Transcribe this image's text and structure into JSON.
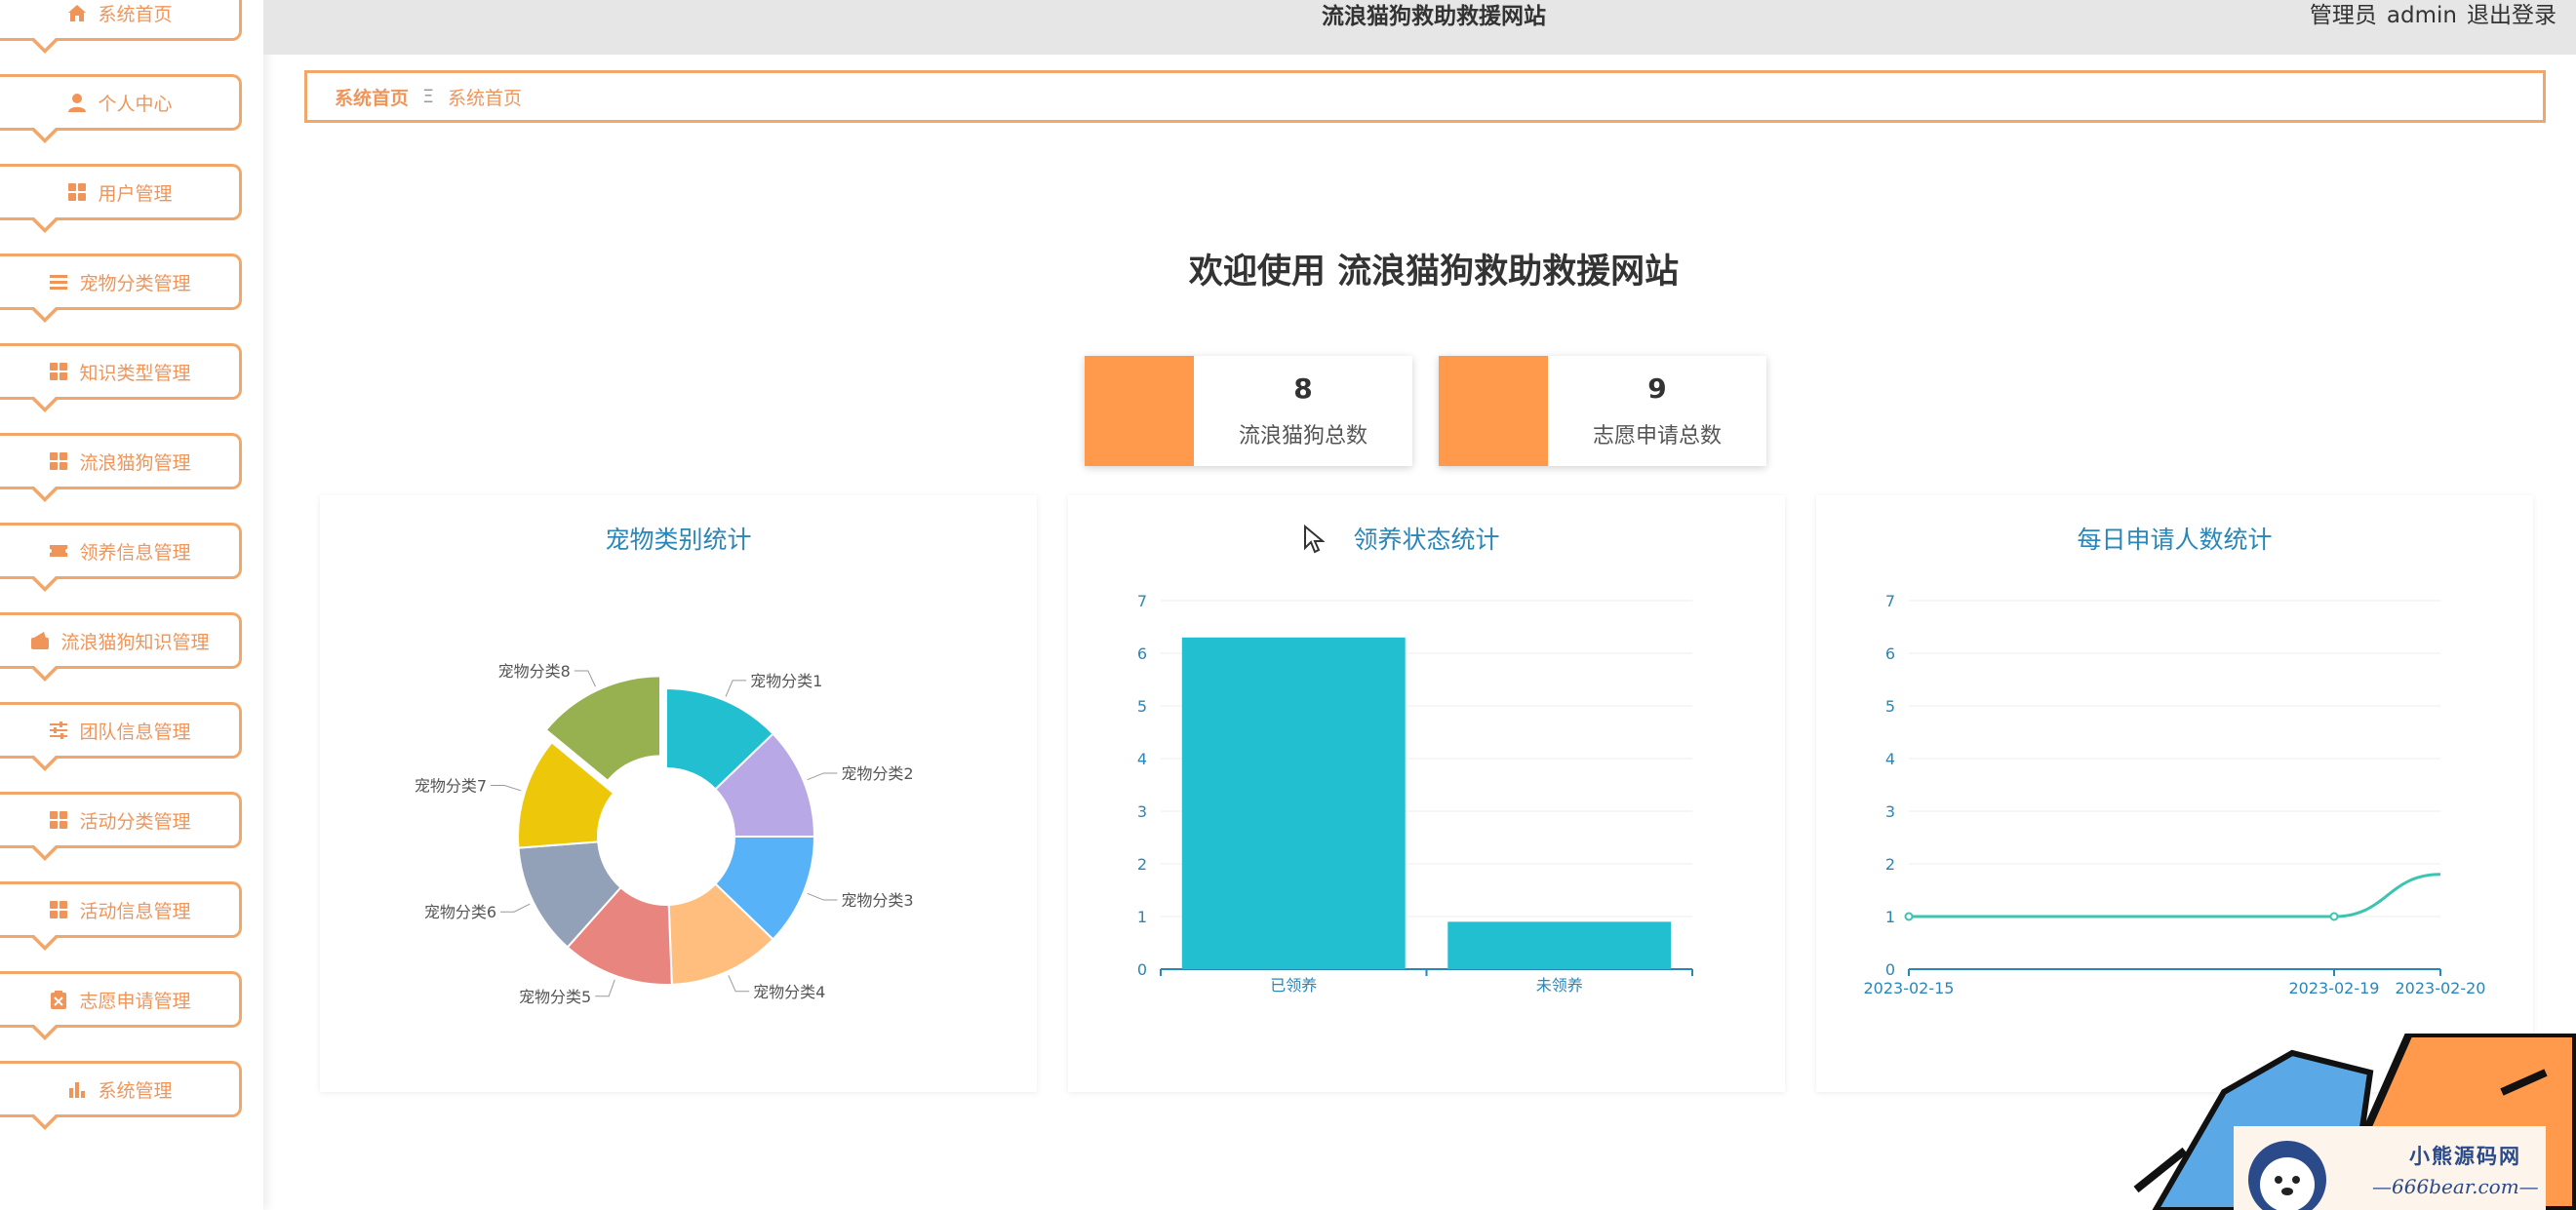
{
  "sidebar": {
    "items": [
      {
        "label": "系统首页",
        "icon": "home-icon"
      },
      {
        "label": "个人中心",
        "icon": "user-icon"
      },
      {
        "label": "用户管理",
        "icon": "grid-icon"
      },
      {
        "label": "宠物分类管理",
        "icon": "list-icon"
      },
      {
        "label": "知识类型管理",
        "icon": "grid-icon"
      },
      {
        "label": "流浪猫狗管理",
        "icon": "grid-icon"
      },
      {
        "label": "领养信息管理",
        "icon": "ticket-icon"
      },
      {
        "label": "流浪猫狗知识管理",
        "icon": "wallet-icon"
      },
      {
        "label": "团队信息管理",
        "icon": "sliders-icon"
      },
      {
        "label": "活动分类管理",
        "icon": "grid-icon"
      },
      {
        "label": "活动信息管理",
        "icon": "grid-icon"
      },
      {
        "label": "志愿申请管理",
        "icon": "clipboard-icon"
      },
      {
        "label": "系统管理",
        "icon": "bar-chart-icon"
      }
    ]
  },
  "header": {
    "title": "流浪猫狗救助救援网站",
    "role": "管理员",
    "username": "admin",
    "logout": "退出登录"
  },
  "breadcrumb": {
    "home": "系统首页",
    "separator": "Ξ",
    "current": "系统首页"
  },
  "welcome": "欢迎使用 流浪猫狗救助救援网站",
  "stats": [
    {
      "value": "8",
      "label": "流浪猫狗总数"
    },
    {
      "value": "9",
      "label": "志愿申请总数"
    }
  ],
  "colors": {
    "accent": "#f0955a",
    "card": "#ff9a4d",
    "title": "#2a86b8",
    "bar": "#22bfd0"
  },
  "chart_data": [
    {
      "type": "pie",
      "title": "宠物类别统计",
      "categories": [
        "宠物分类1",
        "宠物分类2",
        "宠物分类3",
        "宠物分类4",
        "宠物分类5",
        "宠物分类6",
        "宠物分类7",
        "宠物分类8"
      ],
      "values": [
        1.05,
        1.0,
        1.0,
        1.0,
        1.0,
        1.0,
        1.0,
        1.15
      ],
      "colors": [
        "#22bfd0",
        "#b8a9e6",
        "#58b2f8",
        "#ffbe7d",
        "#e8857e",
        "#92a1b8",
        "#edc80a",
        "#97b050"
      ]
    },
    {
      "type": "bar",
      "title": "领养状态统计",
      "categories": [
        "已领养",
        "未领养"
      ],
      "values": [
        6.3,
        0.9
      ],
      "ylim": [
        0,
        7
      ],
      "yticks": [
        "0",
        "1",
        "2",
        "3",
        "4",
        "5",
        "6",
        "7"
      ]
    },
    {
      "type": "line",
      "title": "每日申请人数统计",
      "xticks": [
        "2023-02-15",
        "2023-02-19",
        "2023-02-20"
      ],
      "ylim": [
        0,
        7
      ],
      "yticks": [
        "0",
        "1",
        "2",
        "3",
        "4",
        "5",
        "6",
        "7"
      ],
      "points": [
        [
          "2023-02-15",
          1
        ],
        [
          "2023-02-19",
          1
        ],
        [
          "2023-02-20",
          1.8
        ]
      ]
    }
  ],
  "watermark": {
    "brand": "小熊源码网",
    "url": "—666bear.com—"
  }
}
